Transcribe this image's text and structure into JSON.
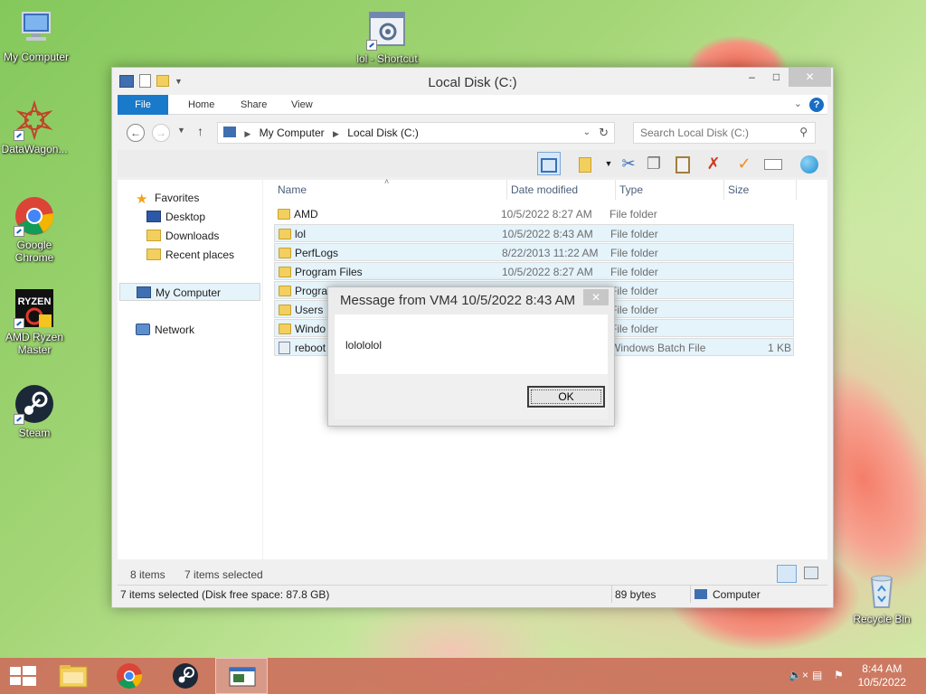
{
  "desktop": {
    "icons": [
      {
        "label": "My Computer"
      },
      {
        "label": "DataWagon..."
      },
      {
        "label": "Google Chrome"
      },
      {
        "label": "AMD Ryzen Master"
      },
      {
        "label": "Steam"
      },
      {
        "label": "lol - Shortcut"
      },
      {
        "label": "Recycle Bin"
      }
    ]
  },
  "window": {
    "title": "Local Disk (C:)",
    "controls": {
      "minimize": "–",
      "maximize": "□",
      "close": "✕"
    },
    "ribbon_tabs": [
      "File",
      "Home",
      "Share",
      "View"
    ],
    "help": "?",
    "address": {
      "crumbs": [
        "My Computer",
        "Local Disk (C:)"
      ]
    },
    "search": {
      "placeholder": "Search Local Disk (C:)"
    },
    "nav": {
      "favorites": "Favorites",
      "items": [
        "Desktop",
        "Downloads",
        "Recent places"
      ],
      "my_computer": "My Computer",
      "network": "Network"
    },
    "columns": {
      "name": "Name",
      "date": "Date modified",
      "type": "Type",
      "size": "Size"
    },
    "files": [
      {
        "name": "AMD",
        "date": "10/5/2022 8:27 AM",
        "type": "File folder",
        "size": ""
      },
      {
        "name": "lol",
        "date": "10/5/2022 8:43 AM",
        "type": "File folder",
        "size": ""
      },
      {
        "name": "PerfLogs",
        "date": "8/22/2013 11:22 AM",
        "type": "File folder",
        "size": ""
      },
      {
        "name": "Program Files",
        "date": "10/5/2022 8:27 AM",
        "type": "File folder",
        "size": ""
      },
      {
        "name": "Progra",
        "date": "",
        "type": "File folder",
        "size": ""
      },
      {
        "name": "Users",
        "date": "",
        "type": "File folder",
        "size": ""
      },
      {
        "name": "Windo",
        "date": "",
        "type": "File folder",
        "size": ""
      },
      {
        "name": "reboot",
        "date": "",
        "type": "Windows Batch File",
        "size": "1 KB"
      }
    ],
    "status_items": "8 items",
    "status_selected": "7 items selected",
    "statusbar": {
      "left": "7 items selected (Disk free space: 87.8 GB)",
      "size": "89 bytes",
      "location": "Computer"
    }
  },
  "dialog": {
    "title": "Message from VM4 10/5/2022 8:43 AM",
    "close": "✕",
    "message": "lolololol",
    "ok": "OK"
  },
  "taskbar": {
    "time": "8:44 AM",
    "date": "10/5/2022"
  },
  "colors": {
    "accent": "#1979ca",
    "taskbar": "#cc705c",
    "selection": "#e5f3fb"
  }
}
